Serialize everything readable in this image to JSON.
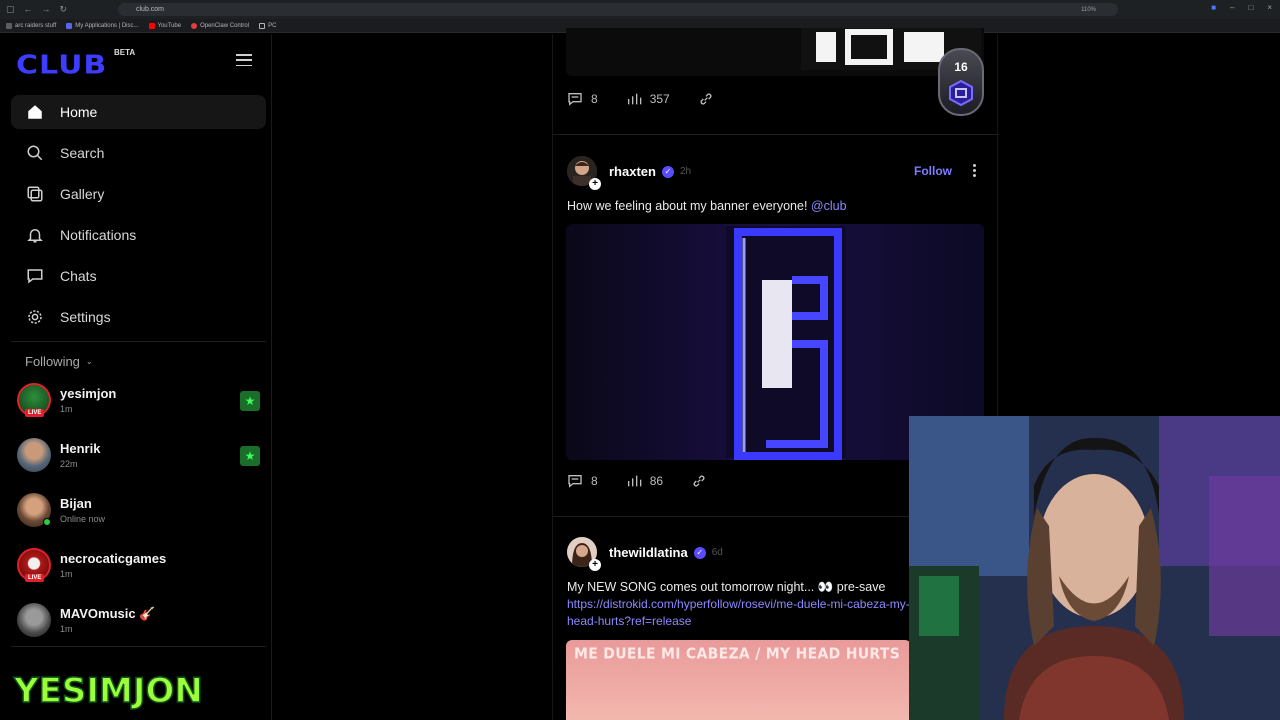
{
  "browser": {
    "url": "club.com",
    "zoom": "110%",
    "bookmarks": [
      "arc raiders stuff",
      "My Applications | Disc...",
      "YouTube",
      "OpenClaw Control",
      "PC"
    ]
  },
  "sidebar": {
    "logo": "CLUB",
    "beta": "BETA",
    "nav": [
      {
        "label": "Home",
        "icon": "home-icon",
        "active": true
      },
      {
        "label": "Search",
        "icon": "search-icon"
      },
      {
        "label": "Gallery",
        "icon": "gallery-icon"
      },
      {
        "label": "Notifications",
        "icon": "bell-icon"
      },
      {
        "label": "Chats",
        "icon": "chat-icon"
      },
      {
        "label": "Settings",
        "icon": "gear-icon"
      }
    ],
    "following_label": "Following",
    "following": [
      {
        "name": "yesimjon",
        "sub": "1m",
        "live": true,
        "starred": true
      },
      {
        "name": "Henrik",
        "sub": "22m",
        "starred": true
      },
      {
        "name": "Bijan",
        "sub": "Online now",
        "online": true
      },
      {
        "name": "necrocaticgames",
        "sub": "1m",
        "live": true
      },
      {
        "name": "MAVOmusic 🎸",
        "sub": "1m"
      }
    ],
    "live_label": "LIVE",
    "watermark": "YESIMJON"
  },
  "feed": {
    "post0": {
      "comments": "8",
      "views": "357",
      "badge": "16"
    },
    "post1": {
      "user": "rhaxten",
      "time": "2h",
      "follow": "Follow",
      "text": "How we feeling about my banner everyone!",
      "mention": "@club",
      "comments": "8",
      "views": "86"
    },
    "post2": {
      "user": "thewildlatina",
      "time": "6d",
      "text": "My NEW SONG comes out tomorrow night... 👀 pre-save",
      "link": "https://distrokid.com/hyperfollow/rosevi/me-duele-mi-cabeza-my-head-hurts?ref=release",
      "media_text": "ME DUELE MI CABEZA / MY HEAD HURTS"
    }
  },
  "colors": {
    "accent": "#7f7cff",
    "logo": "#3d3dff",
    "live": "#e0202a",
    "online": "#2ecc40"
  }
}
